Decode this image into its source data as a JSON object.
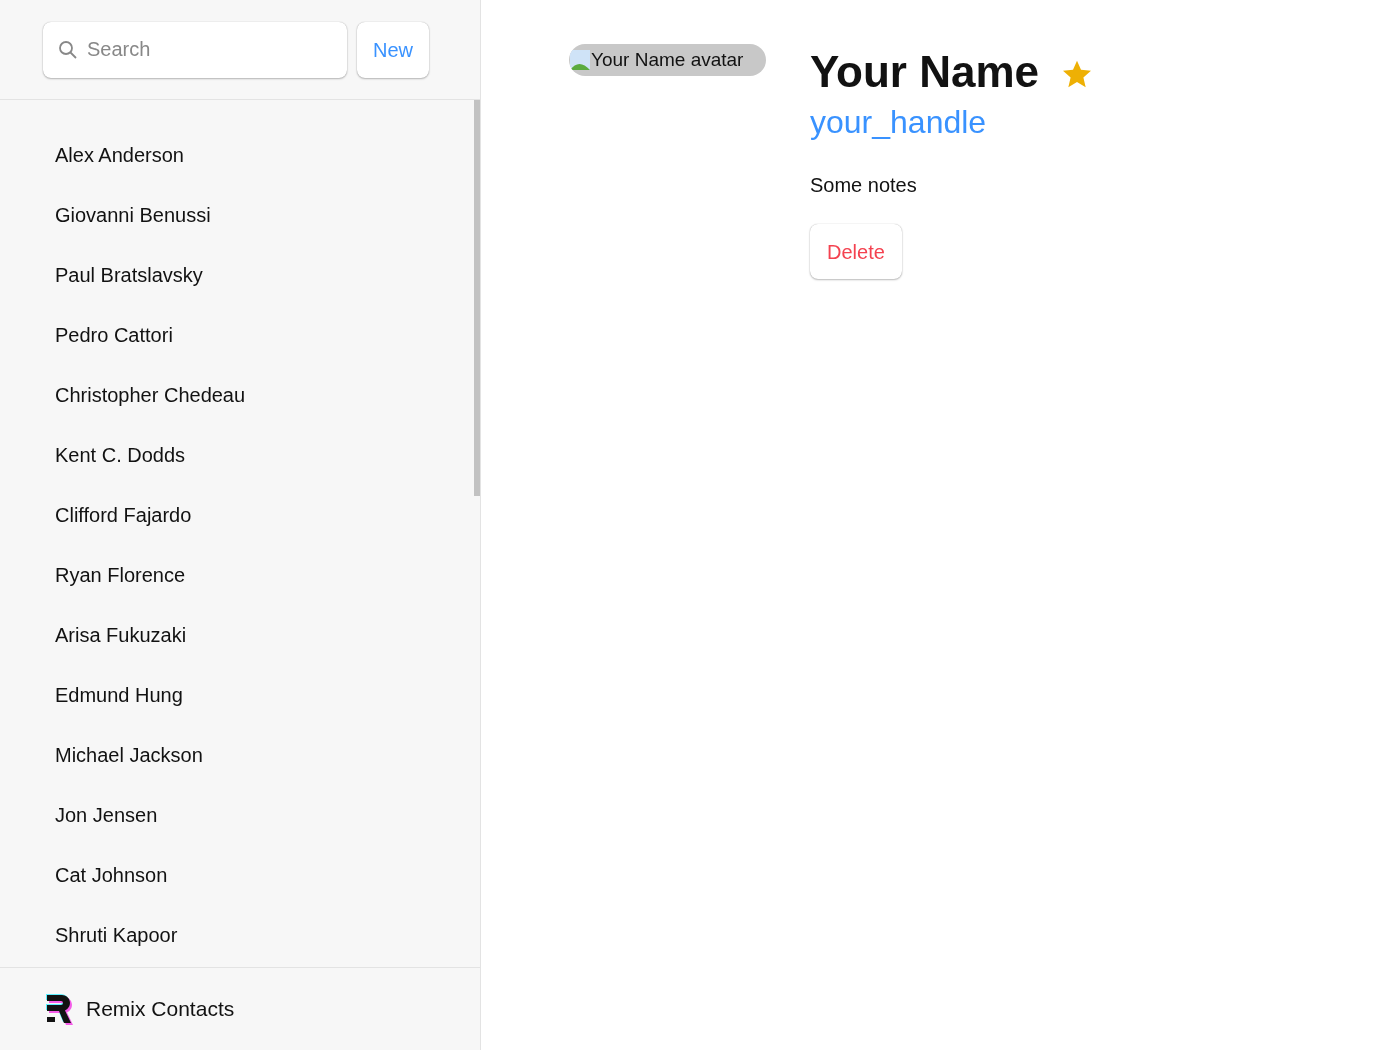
{
  "sidebar": {
    "search": {
      "placeholder": "Search"
    },
    "new_button": "New",
    "contacts": [
      "Alex Anderson",
      "Giovanni Benussi",
      "Paul Bratslavsky",
      "Pedro Cattori",
      "Christopher Chedeau",
      "Kent C. Dodds",
      "Clifford Fajardo",
      "Ryan Florence",
      "Arisa Fukuzaki",
      "Edmund Hung",
      "Michael Jackson",
      "Jon Jensen",
      "Cat Johnson",
      "Shruti Kapoor"
    ],
    "footer": {
      "title": "Remix Contacts"
    }
  },
  "contact": {
    "avatar_alt": "Your Name avatar",
    "name": "Your Name",
    "favorite": true,
    "handle": "your_handle",
    "notes": "Some notes",
    "delete_button": "Delete"
  }
}
